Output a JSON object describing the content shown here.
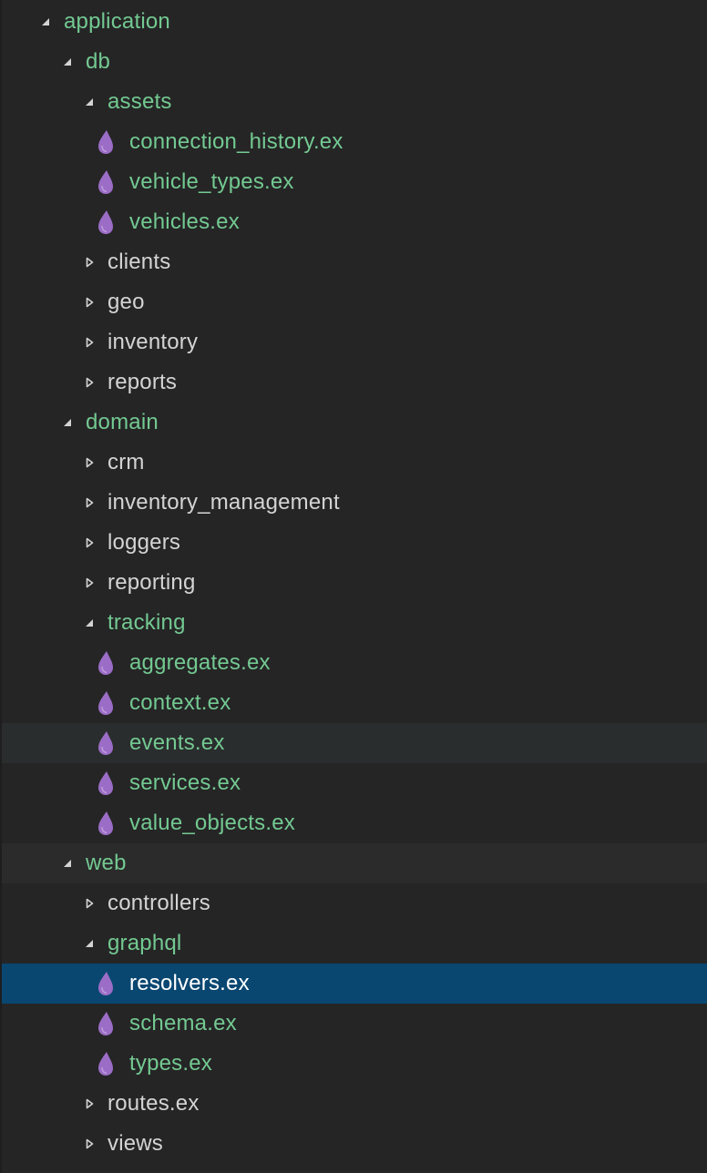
{
  "colors": {
    "background": "#252526",
    "selection": "#094771",
    "hover": "#2a2d2e",
    "modified_text": "#73c991",
    "folder_text": "#d4d4d4",
    "elixir_icon": "#9b6dc6"
  },
  "tree": [
    {
      "label": "application",
      "type": "folder",
      "expanded": true,
      "depth": 0,
      "status": "modified",
      "icon": "chevron-down-icon"
    },
    {
      "label": "db",
      "type": "folder",
      "expanded": true,
      "depth": 1,
      "status": "modified",
      "icon": "chevron-down-icon"
    },
    {
      "label": "assets",
      "type": "folder",
      "expanded": true,
      "depth": 2,
      "status": "modified",
      "icon": "chevron-down-icon"
    },
    {
      "label": "connection_history.ex",
      "type": "file",
      "depth": 3,
      "status": "modified",
      "icon": "elixir-drop-icon"
    },
    {
      "label": "vehicle_types.ex",
      "type": "file",
      "depth": 3,
      "status": "modified",
      "icon": "elixir-drop-icon"
    },
    {
      "label": "vehicles.ex",
      "type": "file",
      "depth": 3,
      "status": "modified",
      "icon": "elixir-drop-icon"
    },
    {
      "label": "clients",
      "type": "folder",
      "expanded": false,
      "depth": 2,
      "status": "normal",
      "icon": "chevron-right-icon"
    },
    {
      "label": "geo",
      "type": "folder",
      "expanded": false,
      "depth": 2,
      "status": "normal",
      "icon": "chevron-right-icon"
    },
    {
      "label": "inventory",
      "type": "folder",
      "expanded": false,
      "depth": 2,
      "status": "normal",
      "icon": "chevron-right-icon"
    },
    {
      "label": "reports",
      "type": "folder",
      "expanded": false,
      "depth": 2,
      "status": "normal",
      "icon": "chevron-right-icon"
    },
    {
      "label": "domain",
      "type": "folder",
      "expanded": true,
      "depth": 1,
      "status": "modified",
      "icon": "chevron-down-icon"
    },
    {
      "label": "crm",
      "type": "folder",
      "expanded": false,
      "depth": 2,
      "status": "normal",
      "icon": "chevron-right-icon"
    },
    {
      "label": "inventory_management",
      "type": "folder",
      "expanded": false,
      "depth": 2,
      "status": "normal",
      "icon": "chevron-right-icon"
    },
    {
      "label": "loggers",
      "type": "folder",
      "expanded": false,
      "depth": 2,
      "status": "normal",
      "icon": "chevron-right-icon"
    },
    {
      "label": "reporting",
      "type": "folder",
      "expanded": false,
      "depth": 2,
      "status": "normal",
      "icon": "chevron-right-icon"
    },
    {
      "label": "tracking",
      "type": "folder",
      "expanded": true,
      "depth": 2,
      "status": "modified",
      "icon": "chevron-down-icon"
    },
    {
      "label": "aggregates.ex",
      "type": "file",
      "depth": 3,
      "status": "modified",
      "icon": "elixir-drop-icon"
    },
    {
      "label": "context.ex",
      "type": "file",
      "depth": 3,
      "status": "modified",
      "icon": "elixir-drop-icon"
    },
    {
      "label": "events.ex",
      "type": "file",
      "depth": 3,
      "status": "modified",
      "icon": "elixir-drop-icon",
      "state": "hover"
    },
    {
      "label": "services.ex",
      "type": "file",
      "depth": 3,
      "status": "modified",
      "icon": "elixir-drop-icon"
    },
    {
      "label": "value_objects.ex",
      "type": "file",
      "depth": 3,
      "status": "modified",
      "icon": "elixir-drop-icon"
    },
    {
      "label": "web",
      "type": "folder",
      "expanded": true,
      "depth": 1,
      "status": "modified",
      "icon": "chevron-down-icon",
      "state": "focus"
    },
    {
      "label": "controllers",
      "type": "folder",
      "expanded": false,
      "depth": 2,
      "status": "normal",
      "icon": "chevron-right-icon"
    },
    {
      "label": "graphql",
      "type": "folder",
      "expanded": true,
      "depth": 2,
      "status": "modified",
      "icon": "chevron-down-icon"
    },
    {
      "label": "resolvers.ex",
      "type": "file",
      "depth": 3,
      "status": "modified",
      "icon": "elixir-drop-icon",
      "state": "selected"
    },
    {
      "label": "schema.ex",
      "type": "file",
      "depth": 3,
      "status": "modified",
      "icon": "elixir-drop-icon"
    },
    {
      "label": "types.ex",
      "type": "file",
      "depth": 3,
      "status": "modified",
      "icon": "elixir-drop-icon"
    },
    {
      "label": "routes.ex",
      "type": "folder",
      "expanded": false,
      "depth": 2,
      "status": "normal",
      "icon": "chevron-right-icon"
    },
    {
      "label": "views",
      "type": "folder",
      "expanded": false,
      "depth": 2,
      "status": "normal",
      "icon": "chevron-right-icon"
    }
  ]
}
